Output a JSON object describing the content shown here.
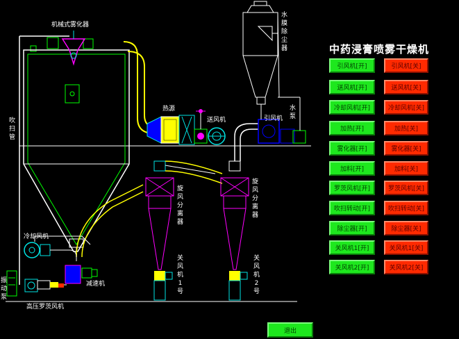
{
  "title": "中药浸膏喷雾干燥机",
  "labels": {
    "atomizer": "机械式雾化器",
    "water_film_dust_collector": "水膜除尘器",
    "sweep_pipe": "吹扫管",
    "heat_source": "热源",
    "supply_fan": "送风机",
    "induced_fan": "引风机",
    "water_pump": "水泵",
    "cyclone_separator_1": "旋风分离器",
    "cyclone_separator_2": "旋风分离器",
    "cooling_fan": "冷却风机",
    "reducer": "减速机",
    "vibration_pump": "振动泵",
    "roots_blower": "高压罗茨风机",
    "air_lock_1": "关风机1号",
    "air_lock_2": "关风机2号"
  },
  "controls": [
    {
      "name": "induced-fan",
      "on": "引风机[开]",
      "off": "引风机[关]"
    },
    {
      "name": "supply-fan",
      "on": "送风机[开]",
      "off": "送风机[关]"
    },
    {
      "name": "cooling-fan",
      "on": "冷却风机[开]",
      "off": "冷却风机[关]"
    },
    {
      "name": "heating",
      "on": "加热[开]",
      "off": "加热[关]"
    },
    {
      "name": "atomizer",
      "on": "雾化器[开]",
      "off": "雾化器[关]"
    },
    {
      "name": "feeding",
      "on": "加料[开]",
      "off": "加料[关]"
    },
    {
      "name": "roots-blower",
      "on": "罗茨风机[开]",
      "off": "罗茨风机[关]"
    },
    {
      "name": "sweep-rotation",
      "on": "吹扫转动[开]",
      "off": "吹扫转动[关]"
    },
    {
      "name": "dust-removal",
      "on": "除尘器[开]",
      "off": "除尘器[关]"
    },
    {
      "name": "air-lock-1",
      "on": "关风机1[开]",
      "off": "关风机1[关]"
    },
    {
      "name": "air-lock-2",
      "on": "关风机2[开]",
      "off": "关风机2[关]"
    }
  ],
  "exit_label": "退出",
  "colors": {
    "background": "#000000",
    "on": "#1ee81e",
    "off": "#ff2a00",
    "outline": "#00ff00",
    "cyan": "#00e5e5",
    "magenta": "#ff00ff",
    "yellow": "#ffff00"
  }
}
